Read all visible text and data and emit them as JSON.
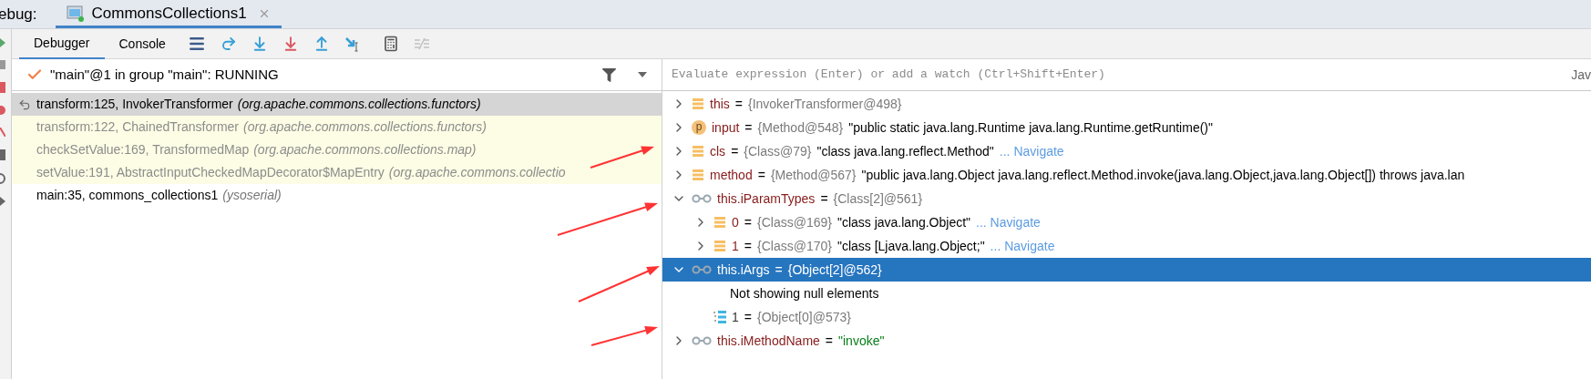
{
  "header": {
    "label": "ebug:",
    "tabs": [
      {
        "title": "CommonsCollections1",
        "selected": true
      }
    ]
  },
  "toolbar": {
    "tabs": [
      {
        "label": "Debugger",
        "selected": true
      },
      {
        "label": "Console",
        "selected": false
      }
    ],
    "actions": [
      {
        "kind": "layout"
      },
      {
        "kind": "step_over"
      },
      {
        "kind": "step_into"
      },
      {
        "kind": "force_step_into"
      },
      {
        "kind": "step_out"
      },
      {
        "kind": "run_to_cursor"
      },
      {
        "kind": "evaluate"
      },
      {
        "kind": "trace",
        "disabled": true
      }
    ]
  },
  "thread": {
    "label": "\"main\"@1 in group \"main\": RUNNING"
  },
  "frames": [
    {
      "method": "transform:125, InvokerTransformer",
      "package": "(org.apache.commons.collections.functors)",
      "selected": true,
      "library": false
    },
    {
      "method": "transform:122, ChainedTransformer",
      "package": "(org.apache.commons.collections.functors)",
      "selected": false,
      "library": true
    },
    {
      "method": "checkSetValue:169, TransformedMap",
      "package": "(org.apache.commons.collections.map)",
      "selected": false,
      "library": true
    },
    {
      "method": "setValue:191, AbstractInputCheckedMapDecorator$MapEntry",
      "package": "(org.apache.commons.collectio",
      "selected": false,
      "library": true
    },
    {
      "method": "main:35, commons_collections1",
      "package": "(ysoserial)",
      "selected": false,
      "library": false
    }
  ],
  "evaluate": {
    "placeholder": "Evaluate expression (Enter) or add a watch (Ctrl+Shift+Enter)",
    "language": "Jav"
  },
  "variables": [
    {
      "kind": "field",
      "name": "this",
      "assign": "=",
      "type": "{InvokerTransformer@498}",
      "expanded": false,
      "selected": false
    },
    {
      "kind": "param",
      "badge": "p",
      "name": "input",
      "assign": "=",
      "type": "{Method@548}",
      "value": "\"public static java.lang.Runtime java.lang.Runtime.getRuntime()\"",
      "string_literal": false,
      "expanded": false,
      "selected": false
    },
    {
      "kind": "field",
      "name": "cls",
      "assign": "=",
      "type": "{Class@79}",
      "value": "\"class java.lang.reflect.Method\"",
      "string_literal": false,
      "link": "... Navigate",
      "expanded": false,
      "selected": false
    },
    {
      "kind": "field",
      "name": "method",
      "assign": "=",
      "type": "{Method@567}",
      "value": "\"public java.lang.Object java.lang.reflect.Method.invoke(java.lang.Object,java.lang.Object[]) throws java.lan",
      "string_literal": false,
      "expanded": false,
      "selected": false
    },
    {
      "kind": "watch",
      "name": "this.iParamTypes",
      "assign": "=",
      "type": "{Class[2]@561}",
      "expanded": true,
      "selected": false,
      "children": [
        {
          "kind": "field",
          "name": "0",
          "assign": "=",
          "type": "{Class@169}",
          "value": "\"class java.lang.Object\"",
          "string_literal": false,
          "link": "... Navigate",
          "expanded": false,
          "selected": false
        },
        {
          "kind": "field",
          "name": "1",
          "assign": "=",
          "type": "{Class@170}",
          "value": "\"class [Ljava.lang.Object;\"",
          "string_literal": false,
          "link": "... Navigate",
          "expanded": false,
          "selected": false
        }
      ]
    },
    {
      "kind": "watch",
      "name": "this.iArgs",
      "assign": "=",
      "type": "{Object[2]@562}",
      "expanded": true,
      "selected": true,
      "children": [
        {
          "kind": "message",
          "text": "Not showing null elements"
        },
        {
          "kind": "array_item",
          "name": "1",
          "assign": "=",
          "type": "{Object[0]@573}"
        }
      ]
    },
    {
      "kind": "watch",
      "name": "this.iMethodName",
      "assign": "=",
      "value": "\"invoke\"",
      "string_literal": true,
      "expanded": false,
      "selected": false
    }
  ]
}
